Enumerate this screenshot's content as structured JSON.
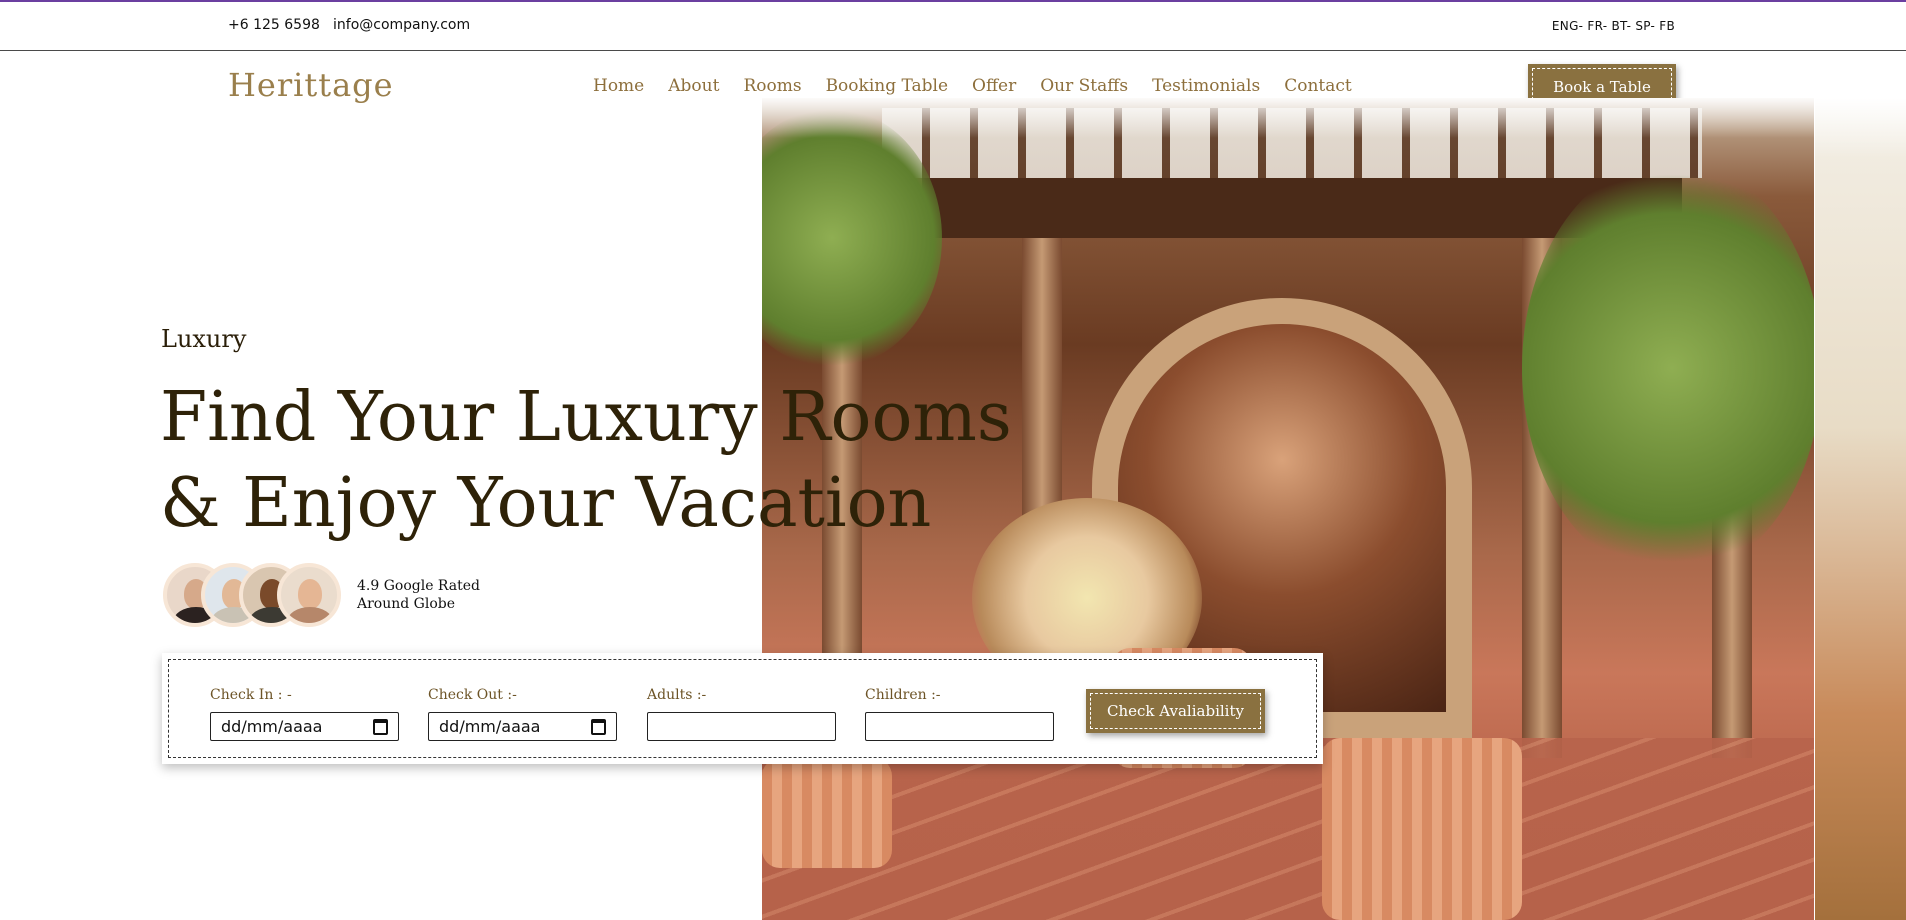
{
  "topbar": {
    "phone": "+6 125 6598",
    "email": "info@company.com",
    "languages": "ENG- FR- BT- SP- FB"
  },
  "header": {
    "logo": "Herittage",
    "nav": [
      "Home",
      "About",
      "Rooms",
      "Booking Table",
      "Offer",
      "Our Staffs",
      "Testimonials",
      "Contact"
    ],
    "cta_label": "Book a Table"
  },
  "hero": {
    "subtitle": "Luxury",
    "headline_line1": "Find Your Luxury Rooms",
    "headline_line2": "& Enjoy Your Vacation",
    "rating_line1": "4.9 Google Rated",
    "rating_line2": "Around Globe"
  },
  "booking": {
    "check_in_label": "Check In : -",
    "check_in_value": "dd/mm/aaaa",
    "check_out_label": "Check Out :-",
    "check_out_value": "dd/mm/aaaa",
    "adults_label": "Adults :-",
    "adults_value": "",
    "children_label": "Children :-",
    "children_value": "",
    "submit_label": "Check Avaliability"
  },
  "colors": {
    "brand": "#8a7140",
    "nav_text": "#8d6f3c",
    "heading": "#2e2208"
  }
}
